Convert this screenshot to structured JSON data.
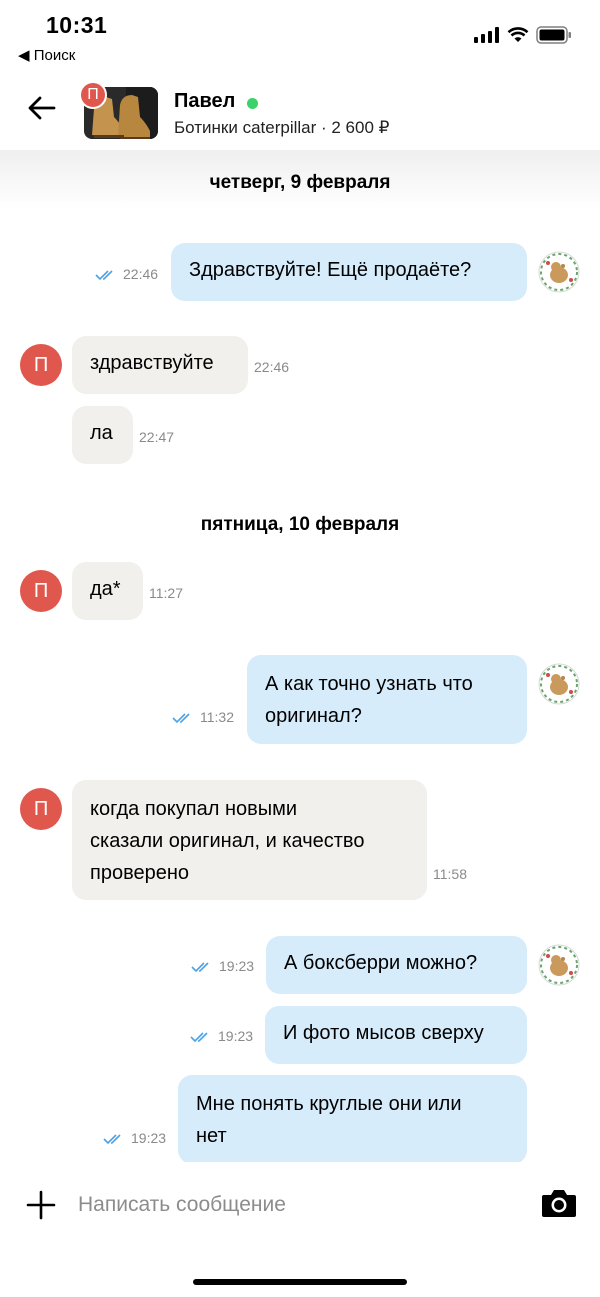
{
  "status": {
    "time": "10:31",
    "back_label": "◀ Поиск"
  },
  "header": {
    "seller_name": "Павел",
    "seller_initial": "П",
    "item_title": "Ботинки caterpillar · 2 600 ₽",
    "online": true
  },
  "chat": {
    "days": [
      "четверг, 9 февраля",
      "пятница, 10 февраля"
    ],
    "messages": [
      {
        "from": "me",
        "text": "Здравствуйте! Ещё продаёте?",
        "time": "22:46",
        "read": true
      },
      {
        "from": "seller",
        "text": "здравствуйте",
        "time": "22:46"
      },
      {
        "from": "seller",
        "text": "ла",
        "time": "22:47"
      },
      {
        "from": "seller",
        "text": "да*",
        "time": "11:27"
      },
      {
        "from": "me",
        "lines": [
          "А как точно узнать что",
          "оригинал?"
        ],
        "time": "11:32",
        "read": true
      },
      {
        "from": "seller",
        "lines": [
          "когда покупал новыми",
          "сказали оригинал, и качество",
          "проверено"
        ],
        "time": "11:58"
      },
      {
        "from": "me",
        "text": "А боксберри можно?",
        "time": "19:23",
        "read": true
      },
      {
        "from": "me",
        "text": "И фото мысов сверху",
        "time": "19:23",
        "read": true
      },
      {
        "from": "me",
        "lines": [
          "Мне понять круглые они или",
          "нет"
        ],
        "time": "19:23",
        "read": true
      }
    ]
  },
  "input": {
    "placeholder": "Написать сообщение"
  },
  "colors": {
    "outgoing": "#d6ecfb",
    "incoming": "#f1f0ec",
    "accent": "#e0584d",
    "online": "#3dd16b",
    "ticks": "#4aa3e8"
  }
}
